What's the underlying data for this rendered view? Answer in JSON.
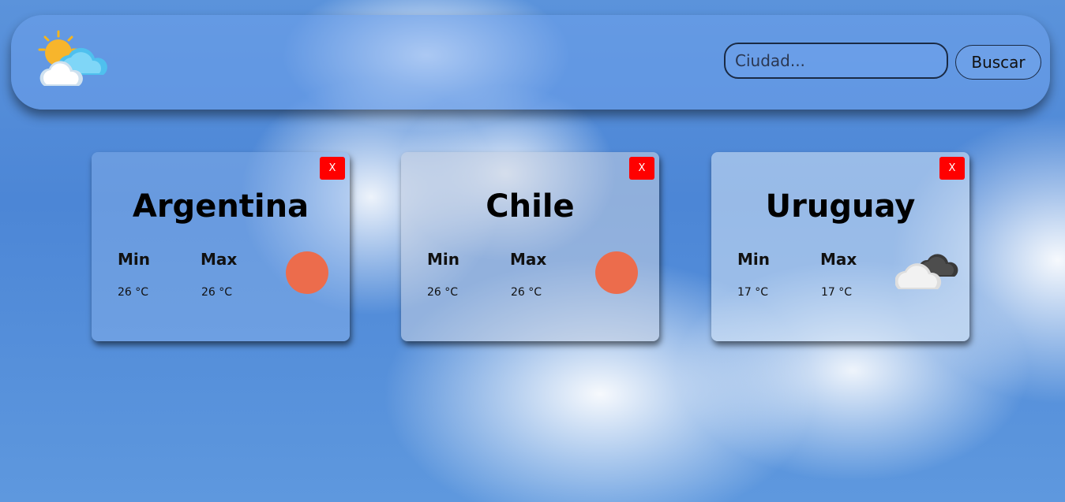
{
  "header": {
    "search": {
      "placeholder": "Ciudad...",
      "value": ""
    },
    "search_button_label": "Buscar"
  },
  "cards": [
    {
      "city": "Argentina",
      "min_label": "Min",
      "max_label": "Max",
      "min_temp": "26 °C",
      "max_temp": "26 °C",
      "icon": "sun-icon",
      "close_label": "X"
    },
    {
      "city": "Chile",
      "min_label": "Min",
      "max_label": "Max",
      "min_temp": "26 °C",
      "max_temp": "26 °C",
      "icon": "sun-icon",
      "close_label": "X"
    },
    {
      "city": "Uruguay",
      "min_label": "Min",
      "max_label": "Max",
      "min_temp": "17 °C",
      "max_temp": "17 °C",
      "icon": "dark-cloud-icon",
      "close_label": "X"
    }
  ],
  "colors": {
    "close_button": "#ff0000",
    "sun": "#ec6c4c",
    "header_bg": "#6ea0eb"
  }
}
